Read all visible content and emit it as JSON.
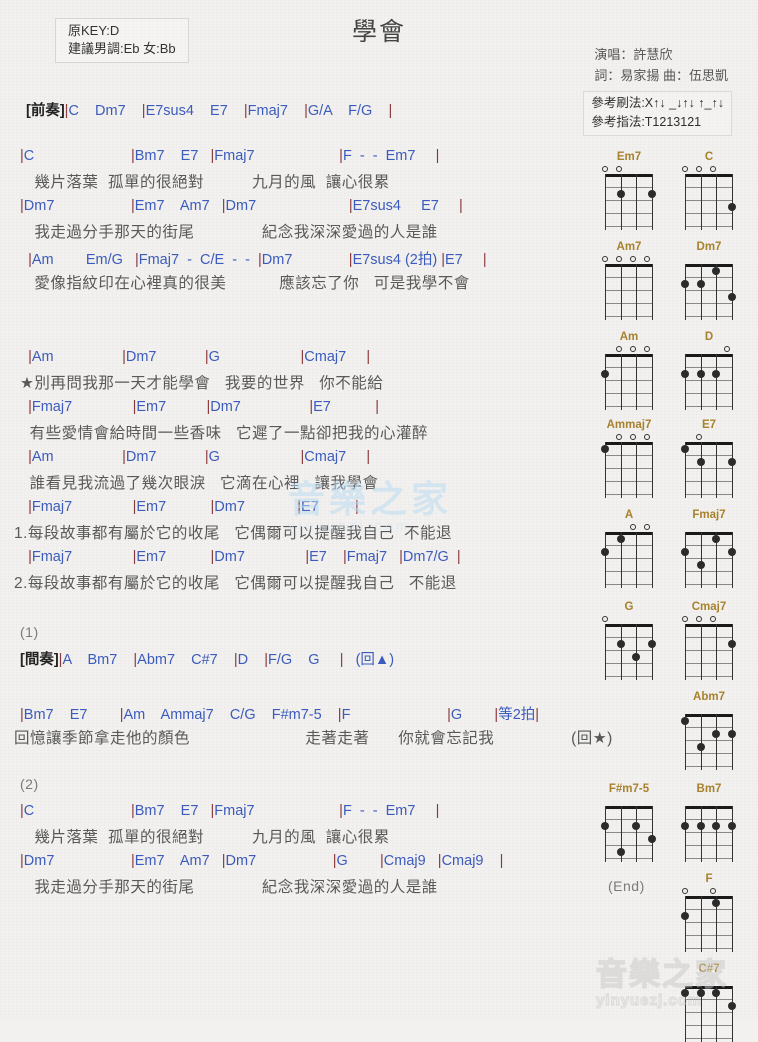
{
  "header": {
    "title": "學會",
    "key_original": "原KEY:D",
    "key_suggest": "建議男調:Eb 女:Bb",
    "singer": "演唱：許慧欣",
    "writer": "詞：易家揚   曲：伍思凱",
    "strum": "參考刷法:X↑↓ _↓↑↓ ↑_↑↓",
    "fingering": "參考指法:T1213121"
  },
  "sections": [
    {
      "name": "intro",
      "label": "[前奏]",
      "chords": "|C    Dm7    |E7sus4    E7    |Fmaj7    |G/A    F/G    |"
    },
    {
      "name": "verse1-line1",
      "chords": "|C                        |Bm7    E7   |Fmaj7                     |F  -  -  Em7     |",
      "lyrics": "   幾片落葉  孤單的很絕對          九月的風  讓心很累"
    },
    {
      "name": "verse1-line2",
      "chords": "|Dm7                   |Em7    Am7   |Dm7                       |E7sus4     E7     |",
      "lyrics": "   我走過分手那天的街尾              紀念我深深愛過的人是誰"
    },
    {
      "name": "verse1-line3",
      "chords": "  |Am        Em/G   |Fmaj7  -  C/E  -  -  |Dm7              |E7sus4 (2拍) |E7     |",
      "lyrics": "   愛像指紋印在心裡真的很美           應該忘了你   可是我學不會"
    },
    {
      "name": "chorus-line1",
      "chords": "  |Am                 |Dm7            |G                    |Cmaj7     |",
      "lyrics": "★別再問我那一天才能學會   我要的世界   你不能給"
    },
    {
      "name": "chorus-line2",
      "chords": "  |Fmaj7               |Em7          |Dm7                 |E7           |",
      "lyrics": "  有些愛情會給時間一些香味   它遲了一點卻把我的心灌醉"
    },
    {
      "name": "chorus-line3",
      "chords": "  |Am                 |Dm7            |G                    |Cmaj7     |",
      "lyrics": "  誰看見我流過了幾次眼淚   它滴在心裡   讓我學會"
    },
    {
      "name": "ending1",
      "chords": "  |Fmaj7               |Em7           |Dm7             |E7         |",
      "lyrics": "1.每段故事都有屬於它的收尾   它偶爾可以提醒我自己  不能退"
    },
    {
      "name": "ending2",
      "chords": "  |Fmaj7               |Em7           |Dm7               |E7    |Fmaj7   |Dm7/G  |",
      "lyrics": "2.每段故事都有屬於它的收尾   它偶爾可以提醒我自己   不能退"
    },
    {
      "name": "marker1",
      "label": "(1)"
    },
    {
      "name": "interlude",
      "label": "[間奏]",
      "chords": "|A    Bm7    |Abm7    C#7    |D    |F/G    G     |   (回▲)"
    },
    {
      "name": "bridge",
      "chords": "|Bm7    E7        |Am    Ammaj7    C/G    F#m7-5    |F                        |G        |等2拍|",
      "lyrics": "回憶讓季節拿走他的顏色                        走著走著      你就會忘記我                (回★)"
    },
    {
      "name": "marker2",
      "label": "(2)"
    },
    {
      "name": "verse2-line1",
      "chords": "|C                        |Bm7    E7   |Fmaj7                     |F  -  -  Em7     |",
      "lyrics": "   幾片落葉  孤單的很絕對          九月的風  讓心很累"
    },
    {
      "name": "verse2-line2",
      "chords": "|Dm7                   |Em7    Am7   |Dm7                   |G        |Cmaj9   |Cmaj9    |",
      "lyrics": "   我走過分手那天的街尾              紀念我深深愛過的人是誰",
      "end_note": "(End)"
    }
  ],
  "diagrams": [
    {
      "name": "Em7",
      "open": [
        1,
        1,
        0,
        0
      ],
      "dots": [
        {
          "s": 1,
          "f": 2
        },
        {
          "s": 3,
          "f": 2
        }
      ]
    },
    {
      "name": "C",
      "open": [
        1,
        1,
        1,
        0
      ],
      "dots": [
        {
          "s": 3,
          "f": 3
        }
      ]
    },
    {
      "name": "Am7",
      "open": [
        1,
        1,
        1,
        1
      ],
      "dots": []
    },
    {
      "name": "Dm7",
      "open": [
        0,
        0,
        0,
        0
      ],
      "dots": [
        {
          "s": 0,
          "f": 2
        },
        {
          "s": 1,
          "f": 2
        },
        {
          "s": 2,
          "f": 1
        },
        {
          "s": 3,
          "f": 3
        }
      ]
    },
    {
      "name": "Am",
      "open": [
        0,
        1,
        1,
        1
      ],
      "dots": [
        {
          "s": 0,
          "f": 2
        }
      ]
    },
    {
      "name": "D",
      "open": [
        0,
        0,
        0,
        1
      ],
      "dots": [
        {
          "s": 0,
          "f": 2
        },
        {
          "s": 1,
          "f": 2
        },
        {
          "s": 2,
          "f": 2
        }
      ]
    },
    {
      "name": "Ammaj7",
      "open": [
        0,
        1,
        1,
        1
      ],
      "dots": [
        {
          "s": 0,
          "f": 1
        }
      ]
    },
    {
      "name": "E7",
      "open": [
        0,
        1,
        0,
        0
      ],
      "dots": [
        {
          "s": 0,
          "f": 1
        },
        {
          "s": 1,
          "f": 2
        },
        {
          "s": 3,
          "f": 2
        }
      ]
    },
    {
      "name": "A",
      "open": [
        0,
        0,
        1,
        1
      ],
      "dots": [
        {
          "s": 0,
          "f": 2
        },
        {
          "s": 1,
          "f": 1
        }
      ]
    },
    {
      "name": "Fmaj7",
      "open": [
        0,
        0,
        0,
        0
      ],
      "dots": [
        {
          "s": 0,
          "f": 2
        },
        {
          "s": 1,
          "f": 3
        },
        {
          "s": 2,
          "f": 1
        },
        {
          "s": 3,
          "f": 2
        }
      ]
    },
    {
      "name": "G",
      "open": [
        1,
        0,
        0,
        0
      ],
      "dots": [
        {
          "s": 1,
          "f": 2
        },
        {
          "s": 2,
          "f": 3
        },
        {
          "s": 3,
          "f": 2
        }
      ]
    },
    {
      "name": "Cmaj7",
      "open": [
        1,
        1,
        1,
        0
      ],
      "dots": [
        {
          "s": 3,
          "f": 2
        }
      ]
    },
    {
      "name": "Abm7",
      "open": [
        0,
        0,
        0,
        0
      ],
      "dots": [
        {
          "s": 0,
          "f": 1
        },
        {
          "s": 1,
          "f": 3
        },
        {
          "s": 2,
          "f": 2
        },
        {
          "s": 3,
          "f": 2
        }
      ]
    },
    {
      "name": "F#m7-5",
      "open": [
        0,
        0,
        0,
        0
      ],
      "dots": [
        {
          "s": 0,
          "f": 2
        },
        {
          "s": 1,
          "f": 4
        },
        {
          "s": 2,
          "f": 2
        },
        {
          "s": 3,
          "f": 3
        }
      ]
    },
    {
      "name": "Bm7",
      "open": [
        0,
        0,
        0,
        0
      ],
      "dots": [
        {
          "s": 0,
          "f": 2
        },
        {
          "s": 1,
          "f": 2
        },
        {
          "s": 2,
          "f": 2
        },
        {
          "s": 3,
          "f": 2
        }
      ]
    },
    {
      "name": "F",
      "open": [
        1,
        0,
        1,
        0
      ],
      "dots": [
        {
          "s": 0,
          "f": 2
        },
        {
          "s": 2,
          "f": 1
        }
      ]
    },
    {
      "name": "C#7",
      "open": [
        0,
        0,
        0,
        0
      ],
      "dots": [
        {
          "s": 0,
          "f": 1
        },
        {
          "s": 1,
          "f": 1
        },
        {
          "s": 2,
          "f": 1
        },
        {
          "s": 3,
          "f": 2
        }
      ]
    }
  ],
  "watermark": {
    "center_text": "音樂之家",
    "center_sub": "yinyuezj.com",
    "bottom_text": "音樂之家",
    "bottom_sub": "yinyuezj.com"
  },
  "colors": {
    "chord": "#3b5bbd",
    "bar": "#8a3a3a",
    "lyric": "#595959",
    "diagram_name": "#a8812d",
    "background": "#f2f1ef"
  }
}
